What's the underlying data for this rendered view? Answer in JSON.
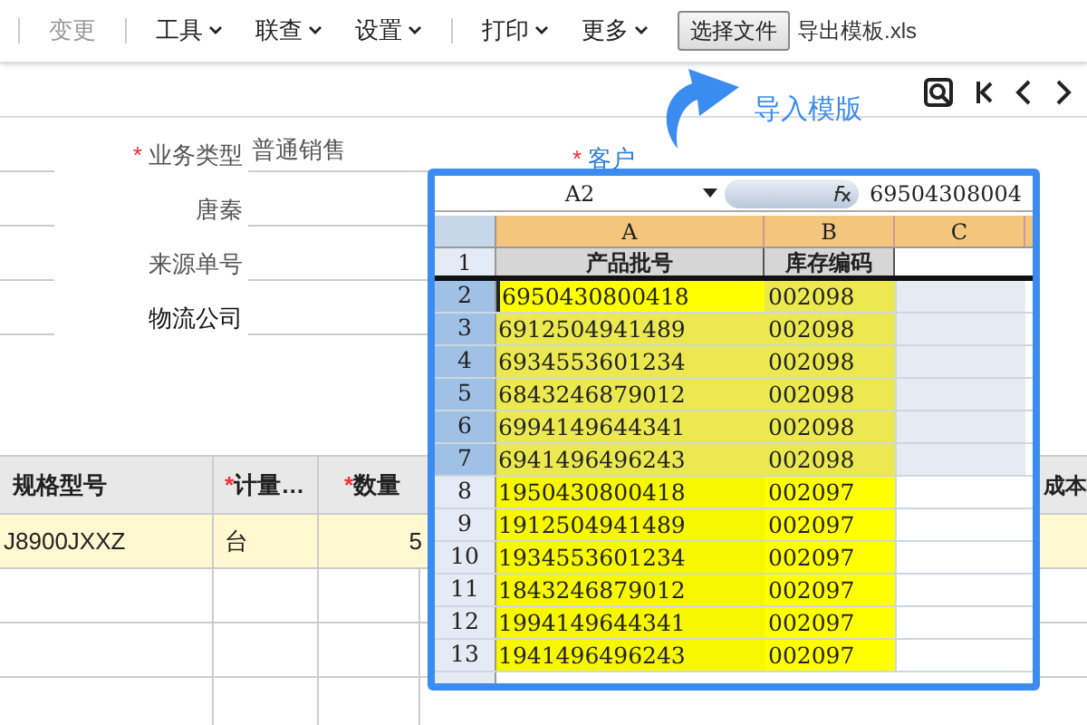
{
  "toolbar": [
    {
      "label": "变更",
      "disabled": true,
      "caret": false
    },
    {
      "label": "工具",
      "disabled": false,
      "caret": true
    },
    {
      "label": "联查",
      "disabled": false,
      "caret": true
    },
    {
      "label": "设置",
      "disabled": false,
      "caret": true
    },
    {
      "label": "打印",
      "disabled": false,
      "caret": true
    },
    {
      "label": "更多",
      "disabled": false,
      "caret": true
    }
  ],
  "file_button": "选择文件",
  "file_name": "导出模板.xls",
  "annotation": "导入模版",
  "form": {
    "fields": [
      {
        "label": "业务类型",
        "required_mark": "*",
        "value": "普通销售"
      },
      {
        "label": "唐秦"
      },
      {
        "label": "来源单号"
      },
      {
        "label": "物流公司"
      }
    ],
    "customer_label": "客户",
    "customer_required_mark": "*"
  },
  "table": {
    "columns": [
      {
        "label": "规格型号"
      },
      {
        "label": "计量…",
        "required_mark": "*"
      },
      {
        "label": "数量",
        "required_mark": "*"
      }
    ],
    "rows": [
      {
        "cells": [
          "J8900JXXZ",
          "台",
          "5"
        ]
      }
    ],
    "side_column": "成本"
  },
  "sheet": {
    "name_box": "A2",
    "formula": "69504308004",
    "columns": [
      "A",
      "B",
      "C"
    ],
    "header_row_number": "1",
    "header_row": [
      "产品批号",
      "库存编码"
    ],
    "rows": [
      {
        "number": "2",
        "a": "6950430800418",
        "b": "002098",
        "selected": true,
        "active": true
      },
      {
        "number": "3",
        "a": "6912504941489",
        "b": "002098",
        "selected": true,
        "active": false
      },
      {
        "number": "4",
        "a": "6934553601234",
        "b": "002098",
        "selected": true,
        "active": false
      },
      {
        "number": "5",
        "a": "6843246879012",
        "b": "002098",
        "selected": true,
        "active": false
      },
      {
        "number": "6",
        "a": "6994149644341",
        "b": "002098",
        "selected": true,
        "active": false
      },
      {
        "number": "7",
        "a": "6941496496243",
        "b": "002098",
        "selected": true,
        "active": false
      },
      {
        "number": "8",
        "a": "1950430800418",
        "b": "002097",
        "selected": false,
        "active": false
      },
      {
        "number": "9",
        "a": "1912504941489",
        "b": "002097",
        "selected": false,
        "active": false
      },
      {
        "number": "10",
        "a": "1934553601234",
        "b": "002097",
        "selected": false,
        "active": false
      },
      {
        "number": "11",
        "a": "1843246879012",
        "b": "002097",
        "selected": false,
        "active": false
      },
      {
        "number": "12",
        "a": "1994149644341",
        "b": "002097",
        "selected": false,
        "active": false
      },
      {
        "number": "13",
        "a": "1941496496243",
        "b": "002097",
        "selected": false,
        "active": false
      }
    ]
  }
}
